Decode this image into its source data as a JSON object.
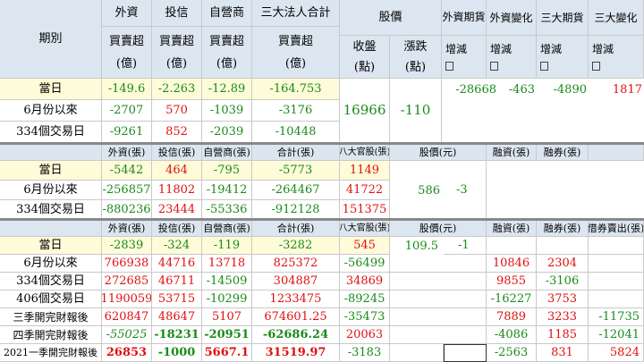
{
  "s1": {
    "header": {
      "period": "期別",
      "foreign": "外資",
      "trust": "投信",
      "dealer": "自營商",
      "three_total": "三大法人合計",
      "net_buy": "買賣超",
      "unit_100m": "(億)",
      "stock_price": "股價",
      "close": "收盤",
      "change": "漲跌",
      "points": "(點)",
      "foreign_futures": "外資期貨",
      "foreign_change": "外資變化",
      "three_futures": "三大期貨",
      "three_change": "三大變化",
      "inc_dec": "增減",
      "box": "□"
    },
    "rows": [
      {
        "label": "當日",
        "foreign": "-149.6",
        "trust": "-2.263",
        "dealer": "-12.89",
        "total": "-164.753"
      },
      {
        "label": "6月份以來",
        "foreign": "-2707",
        "trust": "570",
        "dealer": "-1039",
        "total": "-3176"
      },
      {
        "label": "334個交易日",
        "foreign": "-9261",
        "trust": "852",
        "dealer": "-2039",
        "total": "-10448"
      }
    ],
    "close": "16966",
    "change": "-110",
    "futures": {
      "foreign_futures": "-28668",
      "foreign_change": "-463",
      "three_futures": "-4890",
      "three_change": "1817"
    }
  },
  "s2": {
    "header": {
      "foreign": "外資(張)",
      "trust": "投信(張)",
      "dealer": "自營商(張)",
      "total": "合計(張)",
      "eight": "八大官股(張)",
      "price": "股價(元)",
      "margin": "融資(張)",
      "short": "融券(張)"
    },
    "rows": [
      {
        "label": "當日",
        "foreign": "-5442",
        "trust": "464",
        "dealer": "-795",
        "total": "-5773",
        "eight": "1149"
      },
      {
        "label": "6月份以來",
        "foreign": "-256857",
        "trust": "11802",
        "dealer": "-19412",
        "total": "-264467",
        "eight": "41722"
      },
      {
        "label": "334個交易日",
        "foreign": "-880236",
        "trust": "23444",
        "dealer": "-55336",
        "total": "-912128",
        "eight": "151375"
      }
    ],
    "price": "586",
    "change": "-3"
  },
  "s3": {
    "header": {
      "foreign": "外資(張)",
      "trust": "投信(張)",
      "dealer": "自營商(張)",
      "total": "合計(張)",
      "eight": "八大官股(張)",
      "price": "股價(元)",
      "margin": "融資(張)",
      "short": "融券(張)",
      "lend": "借券賣出(張)"
    },
    "rows": [
      {
        "label": "當日",
        "foreign": "-2839",
        "trust": "-324",
        "dealer": "-119",
        "total": "-3282",
        "eight": "545",
        "margin": "",
        "short": "",
        "lend": ""
      },
      {
        "label": "6月份以來",
        "foreign": "766938",
        "trust": "44716",
        "dealer": "13718",
        "total": "825372",
        "eight": "-56499",
        "margin": "10846",
        "short": "2304",
        "lend": ""
      },
      {
        "label": "334個交易日",
        "foreign": "272685",
        "trust": "46711",
        "dealer": "-14509",
        "total": "304887",
        "eight": "34869",
        "margin": "9855",
        "short": "-3106",
        "lend": ""
      },
      {
        "label": "406個交易日",
        "foreign": "1190059",
        "trust": "53715",
        "dealer": "-10299",
        "total": "1233475",
        "eight": "-89245",
        "margin": "-16227",
        "short": "3753",
        "lend": ""
      },
      {
        "label": "三季開完財報後",
        "foreign": "620847",
        "trust": "48647",
        "dealer": "5107",
        "total": "674601.25",
        "eight": "-35473",
        "margin": "7889",
        "short": "3233",
        "lend": "-11735"
      },
      {
        "label": "四季開完財報後",
        "foreign": "-55025",
        "trust": "-18231",
        "dealer": "-20951",
        "total": "-62686.24",
        "eight": "20063",
        "margin": "-4086",
        "short": "1185",
        "lend": "-12041"
      },
      {
        "label": "2021一季開完財報後",
        "foreign": "26853",
        "trust": "-1000",
        "dealer": "5667.1",
        "total": "31519.97",
        "eight": "-3183",
        "margin": "-2563",
        "short": "831",
        "lend": "5824"
      }
    ],
    "price": "109.5",
    "change": "-1"
  }
}
